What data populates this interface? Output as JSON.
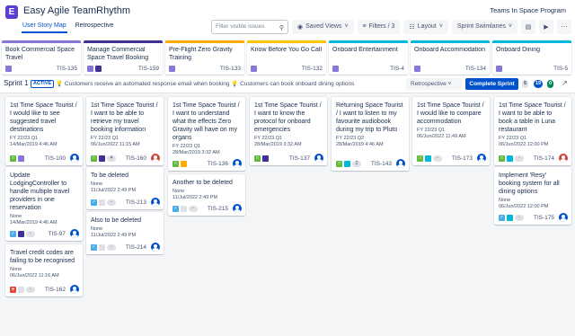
{
  "app": {
    "title": "Easy Agile TeamRhythm",
    "program": "Teams In Space Program",
    "logo_letter": "E"
  },
  "tabs": [
    {
      "label": "User Story Map",
      "active": true
    },
    {
      "label": "Retrospective",
      "active": false
    }
  ],
  "toolbar": {
    "search_placeholder": "Filter visible issues",
    "saved_views": "Saved Views",
    "filters": "Filters / 3",
    "layout": "Layout",
    "swimlanes": "Sprint Swimlanes"
  },
  "epics": [
    {
      "title": "Book Commercial Space Travel",
      "key": "TIS-135",
      "color": "#8777d9"
    },
    {
      "title": "Manage Commercial Space Travel Booking",
      "key": "TIS-159",
      "color": "#403294"
    },
    {
      "title": "Pre-Flight Zero Gravity Training",
      "key": "TIS-133",
      "color": "#ffab00"
    },
    {
      "title": "Know Before You Go Call",
      "key": "TIS-132",
      "color": "#ffc400"
    },
    {
      "title": "Onboard Entertainment",
      "key": "TIS-4",
      "color": "#00b8d9"
    },
    {
      "title": "Onboard Accommodation",
      "key": "TIS-134",
      "color": "#00b8d9"
    },
    {
      "title": "Onboard Dining",
      "key": "TIS-5",
      "color": "#00b8d9"
    }
  ],
  "sprint": {
    "name": "Sprint 1",
    "status": "ACTIVE",
    "goal": "💡 Customers receive an automated response email when booking 💡 Customers can book onboard dining options",
    "retro_select": "Retrospective",
    "complete_label": "Complete Sprint",
    "counts": [
      "5",
      "19",
      "0"
    ]
  },
  "cards": [
    {
      "title": "1st Time Space Tourist / I would like to see suggested travel destinations",
      "meta1": "FY 22/23 Q1",
      "meta2": "14/Mar/2019 4:46 AM",
      "key": "TIS-100",
      "type": "story",
      "epic": "#8777d9",
      "est": "",
      "avatar": "b"
    },
    {
      "title": "Update LodgingController to handle multiple travel providers in one reservation",
      "meta1": "None",
      "meta2": "14/Mar/2019 4:46 AM",
      "key": "TIS-97",
      "type": "task",
      "epic": "#403294",
      "est": "-",
      "avatar": "b"
    },
    {
      "title": "Travel credit codes are failing to be recognised",
      "meta1": "None",
      "meta2": "06/Jun/2022 11:16 AM",
      "key": "TIS-162",
      "type": "bug",
      "epic": "#dfe1e6",
      "est": "-",
      "avatar": "b"
    },
    {
      "title": "1st Time Space Tourist / I want to be able to retrieve my travel booking information",
      "meta1": "FY 22/23 Q1",
      "meta2": "06/Jun/2022 11:15 AM",
      "key": "TIS-160",
      "type": "story",
      "epic": "#403294",
      "est": "4",
      "avatar": "r"
    },
    {
      "title": "To be deleted",
      "meta1": "None",
      "meta2": "11/Jul/2022 2:49 PM",
      "key": "TIS-213",
      "type": "task",
      "epic": "#dfe1e6",
      "est": "-",
      "avatar": "b"
    },
    {
      "title": "Also to be deleted",
      "meta1": "None",
      "meta2": "11/Jul/2022 2:49 PM",
      "key": "TIS-214",
      "type": "task",
      "epic": "#dfe1e6",
      "est": "-",
      "avatar": "b"
    },
    {
      "title": "1st Time Space Tourist / I want to understand what the effects Zero Gravity will have on my organs",
      "meta1": "FY 22/23 Q1",
      "meta2": "28/Mar/2019 3:32 AM",
      "key": "TIS-136",
      "type": "story",
      "epic": "#ffab00",
      "est": "",
      "avatar": "b"
    },
    {
      "title": "Another to be deleted",
      "meta1": "None",
      "meta2": "11/Jul/2022 2:49 PM",
      "key": "TIS-215",
      "type": "task",
      "epic": "#dfe1e6",
      "est": "-",
      "avatar": "b"
    },
    {
      "title": "1st Time Space Tourist / I want to know the protocol for onboard emergencies",
      "meta1": "FY 22/23 Q1",
      "meta2": "28/Mar/2019 3:32 AM",
      "key": "TIS-137",
      "type": "story",
      "epic": "#403294",
      "est": "",
      "avatar": "b"
    },
    {
      "title": "Returning Space Tourist / I want to listen to my favourite audiobook during my trip to Pluto",
      "meta1": "FY 22/23 Q2",
      "meta2": "28/Mar/2019 4:46 AM",
      "key": "TIS-143",
      "type": "story",
      "epic": "#00b8d9",
      "est": "2",
      "avatar": "b"
    },
    {
      "title": "1st Time Space Tourist / I would like to compare accommodation",
      "meta1": "FY 22/23 Q1",
      "meta2": "06/Jun/2022 11:49 AM",
      "key": "TIS-173",
      "type": "story",
      "epic": "#00b8d9",
      "est": "-",
      "avatar": "b"
    },
    {
      "title": "1st Time Space Tourist / I want to be able to book a table in Luna restaurant",
      "meta1": "FY 22/23 Q1",
      "meta2": "06/Jun/2022 12:00 PM",
      "key": "TIS-174",
      "type": "story",
      "epic": "#00b8d9",
      "est": "-",
      "avatar": "r"
    },
    {
      "title": "Implement 'Resy' booking system for all dining options",
      "meta1": "None",
      "meta2": "06/Jun/2022 12:00 PM",
      "key": "TIS-175",
      "type": "task",
      "epic": "#00b8d9",
      "est": "-",
      "avatar": "b"
    }
  ],
  "colors": {
    "story": "#63ba3c",
    "task": "#4bade8",
    "bug": "#e5493a",
    "accent": "#0052cc"
  }
}
